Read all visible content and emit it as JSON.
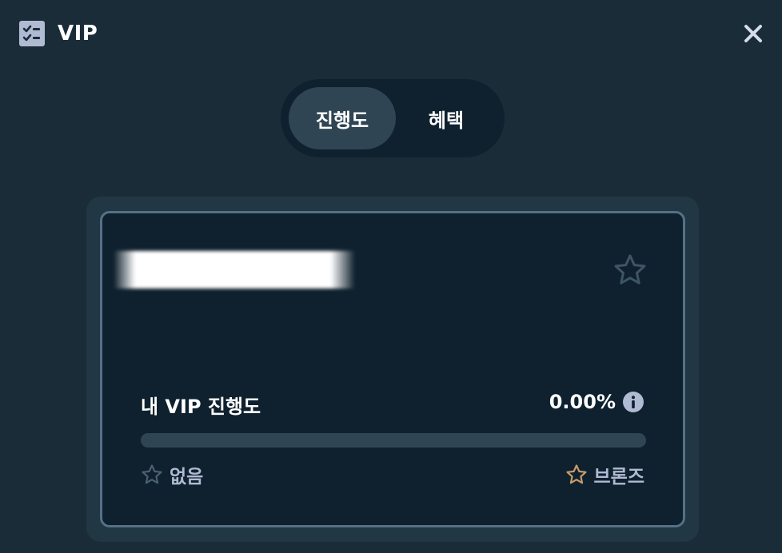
{
  "header": {
    "title": "VIP",
    "icon": "checklist-icon",
    "close_icon": "close-icon"
  },
  "tabs": [
    {
      "label": "진행도",
      "active": true
    },
    {
      "label": "혜택",
      "active": false
    }
  ],
  "card": {
    "rank_icon": "star-outline-icon",
    "progress_label": "내 VIP 진행도",
    "progress_value": "0.00%",
    "progress_fraction": 0.0,
    "info_icon": "info-icon",
    "current_rank": "없음",
    "next_rank": "브론즈"
  },
  "colors": {
    "background": "#1a2c38",
    "card": "#0f212e",
    "card_border": "#557086",
    "track": "#2f4553",
    "bronze": "#c69c6d",
    "muted_star": "#4a6172"
  }
}
